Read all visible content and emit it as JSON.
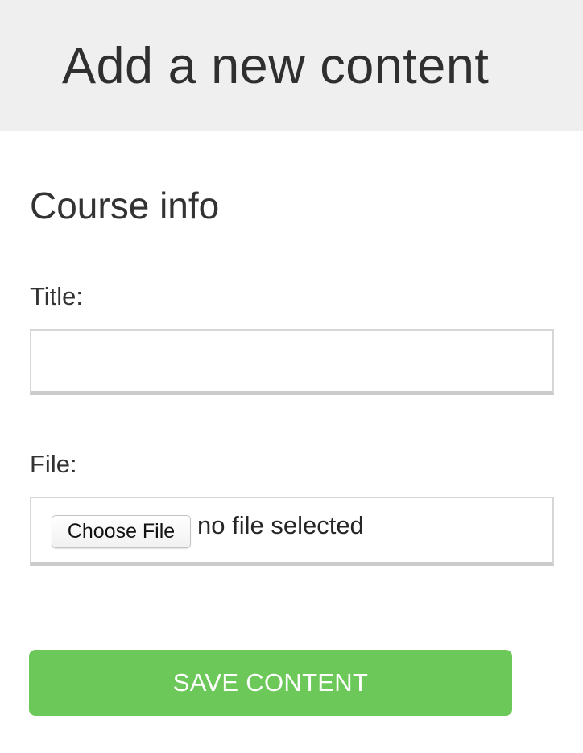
{
  "header": {
    "title": "Add a new content"
  },
  "form": {
    "section_title": "Course info",
    "title_field": {
      "label": "Title:",
      "value": "",
      "placeholder": ""
    },
    "file_field": {
      "label": "File:",
      "button_label": "Choose File",
      "status": "no file selected"
    },
    "submit_label": "SAVE CONTENT"
  },
  "colors": {
    "header_background": "#efefef",
    "submit_background": "#6dc85a",
    "submit_text": "#ffffff"
  }
}
